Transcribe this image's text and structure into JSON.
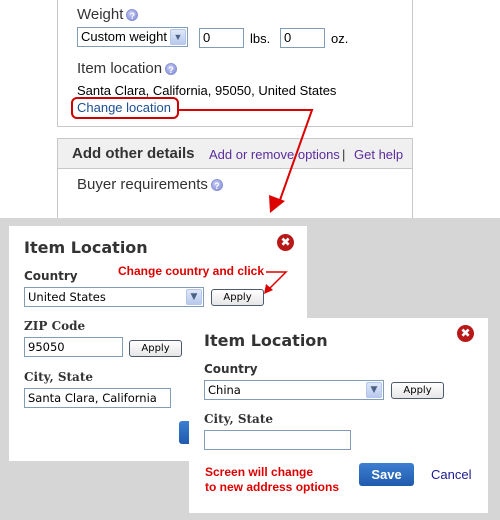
{
  "form": {
    "weight_label": "Weight",
    "weight_type_select": "Custom weight",
    "weight_lbs_value": "0",
    "weight_lbs_unit": "lbs.",
    "weight_oz_value": "0",
    "weight_oz_unit": "oz.",
    "item_location_label": "Item location",
    "item_location_value": "Santa Clara, California, 95050, United States",
    "change_location_link": "Change location",
    "help_icon_glyph": "?"
  },
  "details": {
    "header": "Add other details",
    "add_remove_link": "Add or remove options",
    "separator": "|",
    "get_help_link": "Get help",
    "buyer_requirements_label": "Buyer requirements"
  },
  "dialog_us": {
    "title": "Item Location",
    "country_label": "Country",
    "country_value": "United States",
    "apply_label": "Apply",
    "zip_label": "ZIP Code",
    "zip_value": "95050",
    "zip_apply_label": "Apply",
    "city_state_label": "City, State",
    "city_state_value": "Santa Clara, California",
    "annotation": "Change country and click",
    "close_glyph": "✖"
  },
  "dialog_china": {
    "title": "Item Location",
    "country_label": "Country",
    "country_value": "China",
    "apply_label": "Apply",
    "city_state_label": "City, State",
    "city_state_value": "",
    "annotation_line1": "Screen will change",
    "annotation_line2": "to new address options",
    "save_label": "Save",
    "cancel_label": "Cancel",
    "close_glyph": "✖"
  },
  "colors": {
    "annotation_red": "#dd0000",
    "link_blue": "#1b4f93",
    "link_purple": "#5b2d9c",
    "save_blue": "#1f5aad",
    "close_red": "#b81818",
    "backdrop_gray": "#d6d6d6"
  }
}
